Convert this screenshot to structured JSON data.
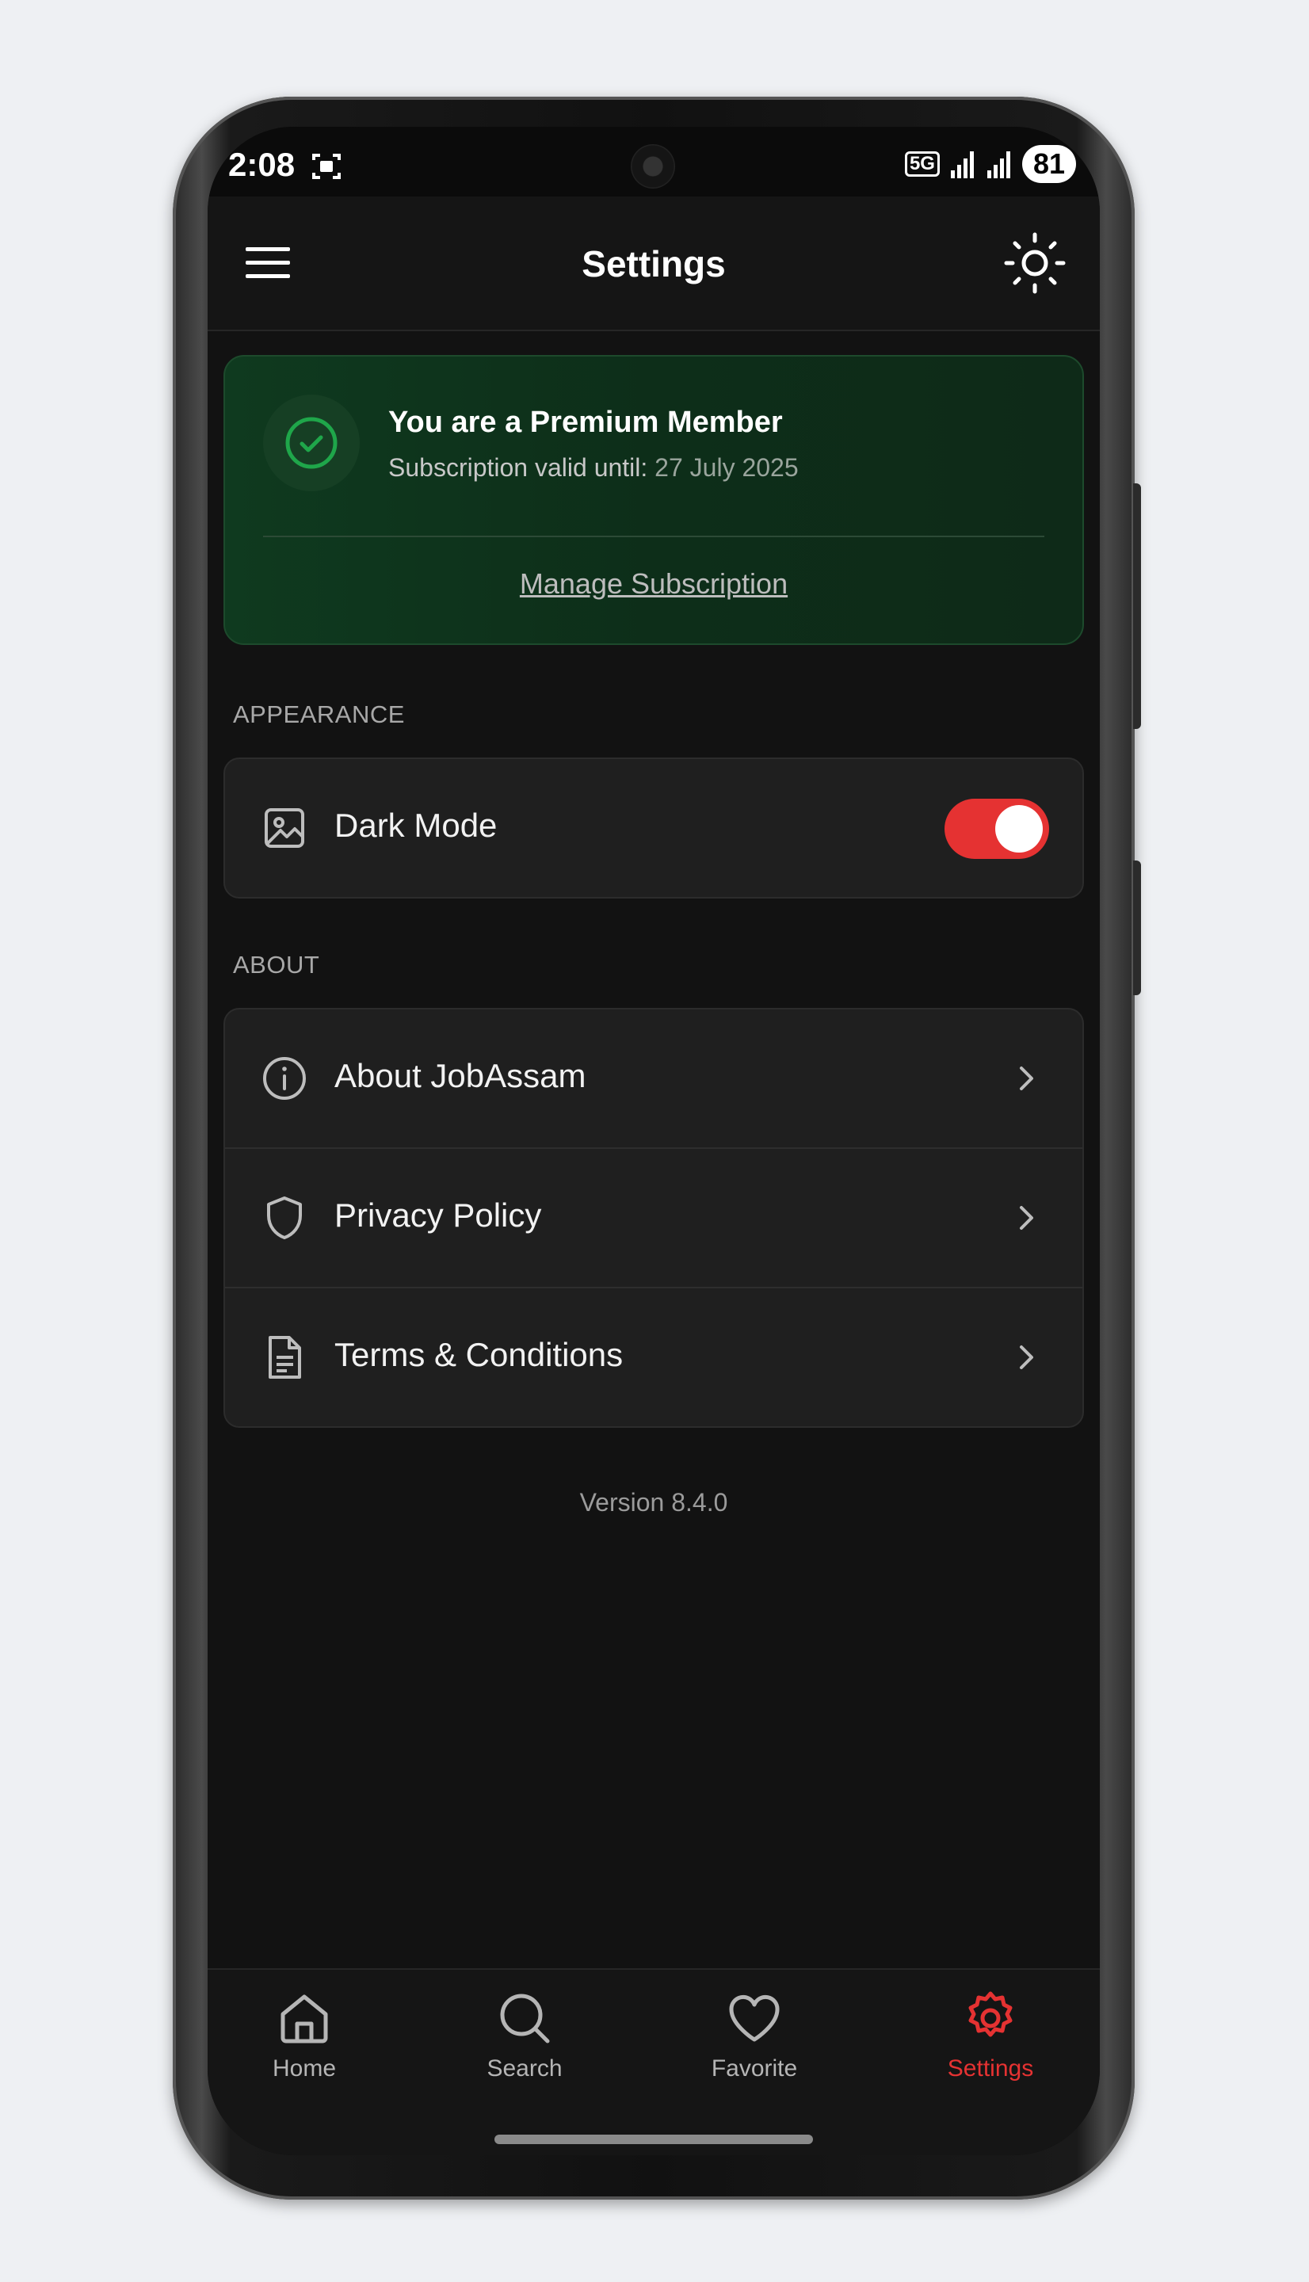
{
  "status_bar": {
    "time": "2:08",
    "network": "5G",
    "battery": "81"
  },
  "app_bar": {
    "title": "Settings",
    "menu_icon": "hamburger-menu-icon",
    "theme_icon": "sun-icon"
  },
  "premium": {
    "title": "You are a Premium Member",
    "subscription_label": "Subscription valid until:",
    "subscription_date": "27 July 2025",
    "manage_label": "Manage Subscription",
    "icon": "check-circle-icon"
  },
  "appearance": {
    "section_label": "APPEARANCE",
    "dark_mode": {
      "label": "Dark Mode",
      "icon": "image-icon",
      "enabled": true
    }
  },
  "about": {
    "section_label": "ABOUT",
    "items": [
      {
        "label": "About JobAssam",
        "icon": "info-icon"
      },
      {
        "label": "Privacy Policy",
        "icon": "shield-icon"
      },
      {
        "label": "Terms & Conditions",
        "icon": "document-icon"
      }
    ]
  },
  "version": "Version 8.4.0",
  "bottom_nav": {
    "items": [
      {
        "label": "Home",
        "icon": "home-icon",
        "active": false
      },
      {
        "label": "Search",
        "icon": "search-icon",
        "active": false
      },
      {
        "label": "Favorite",
        "icon": "heart-icon",
        "active": false
      },
      {
        "label": "Settings",
        "icon": "gear-icon",
        "active": true
      }
    ]
  },
  "colors": {
    "accent": "#e53232",
    "premium_green": "#1fa64a",
    "background": "#121212",
    "card": "#1f1f1f"
  }
}
